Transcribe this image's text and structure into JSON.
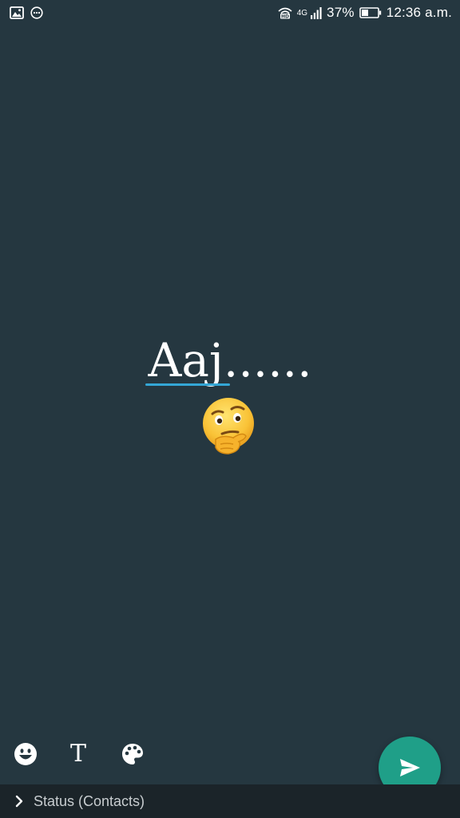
{
  "status_bar": {
    "network": "4G",
    "battery_percent": "37%",
    "time": "12:36 a.m."
  },
  "composer": {
    "text": "Aaj......",
    "emoji": "thinking-face"
  },
  "tools": {
    "text_tool_label": "T"
  },
  "audience": {
    "label": "Status (Contacts)"
  },
  "colors": {
    "background": "#253740",
    "send_button": "#1f9f88",
    "cursor_underline": "#34a7d6",
    "bottom_bar": "#1b2429"
  }
}
